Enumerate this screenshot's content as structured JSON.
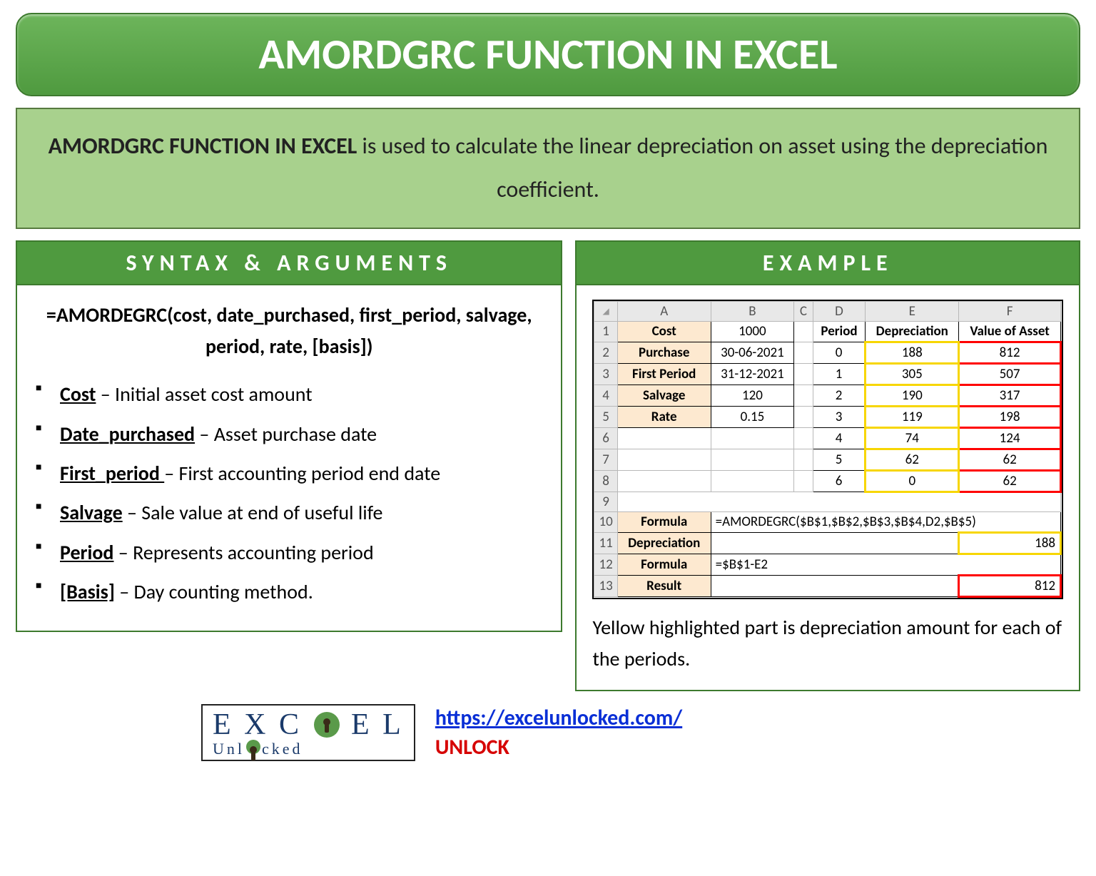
{
  "title": "AMORDGRC FUNCTION IN EXCEL",
  "description": {
    "bold": "AMORDGRC FUNCTION IN EXCEL",
    "rest": " is used to calculate the linear depreciation on asset using the depreciation coefficient."
  },
  "sections": {
    "syntax_title": "SYNTAX & ARGUMENTS",
    "example_title": "EXAMPLE"
  },
  "syntax_formula": "=AMORDEGRC(cost, date_purchased, first_period, salvage, period, rate, [basis])",
  "arguments": [
    {
      "name": "Cost",
      "desc": " – Initial asset cost amount"
    },
    {
      "name": "Date_purchased",
      "desc": " – Asset purchase date"
    },
    {
      "name": "First_period ",
      "desc": "– First accounting period end date"
    },
    {
      "name": "Salvage",
      "desc": " – Sale value at end of useful life"
    },
    {
      "name": "Period",
      "desc": " – Represents accounting period"
    },
    {
      "name": "[Basis]",
      "desc": " – Day counting method."
    }
  ],
  "sheet": {
    "cols": [
      "A",
      "B",
      "C",
      "D",
      "E",
      "F"
    ],
    "labels": {
      "cost": "Cost",
      "purchase": "Purchase",
      "first_period": "First Period",
      "salvage": "Salvage",
      "rate": "Rate",
      "period": "Period",
      "depreciation": "Depreciation",
      "value_of_asset": "Value of Asset",
      "formula": "Formula",
      "depreciation_row": "Depreciation",
      "result": "Result"
    },
    "inputs": {
      "cost": "1000",
      "purchase": "30-06-2021",
      "first_period": "31-12-2021",
      "salvage": "120",
      "rate": "0.15"
    },
    "periods": [
      {
        "p": "0",
        "dep": "188",
        "va": "812"
      },
      {
        "p": "1",
        "dep": "305",
        "va": "507"
      },
      {
        "p": "2",
        "dep": "190",
        "va": "317"
      },
      {
        "p": "3",
        "dep": "119",
        "va": "198"
      },
      {
        "p": "4",
        "dep": "74",
        "va": "124"
      },
      {
        "p": "5",
        "dep": "62",
        "va": "62"
      },
      {
        "p": "6",
        "dep": "0",
        "va": "62"
      }
    ],
    "formula1": "=AMORDEGRC($B$1,$B$2,$B$3,$B$4,D2,$B$5)",
    "dep_result": "188",
    "formula2": "=$B$1-E2",
    "result": "812"
  },
  "example_note": "Yellow highlighted part is depreciation amount for each of the periods.",
  "footer": {
    "logo_top": "EXC EL",
    "logo_bottom_prefix": "Unl",
    "logo_bottom_suffix": "cked",
    "url": "https://excelunlocked.com/",
    "unlock": "UNLOCK"
  }
}
